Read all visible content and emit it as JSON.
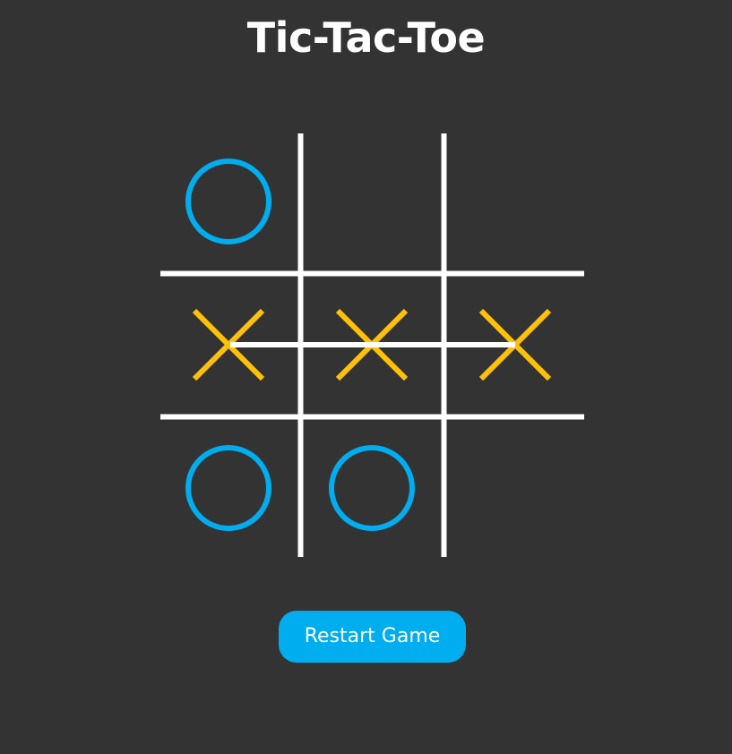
{
  "title": "Tic-Tac-Toe",
  "restart_label": "Restart Game",
  "board": [
    [
      "O",
      "",
      ""
    ],
    [
      "X",
      "X",
      "X"
    ],
    [
      "O",
      "O",
      ""
    ]
  ],
  "winning_line": "row-2",
  "colors": {
    "background": "#333333",
    "grid": "#ffffff",
    "o_mark": "#00adee",
    "x_mark": "#ffc107",
    "button": "#00adee",
    "text": "#ffffff"
  }
}
